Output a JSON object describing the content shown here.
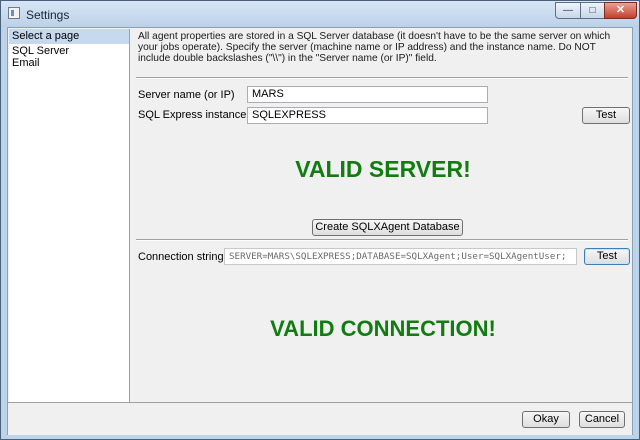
{
  "window": {
    "title": "Settings"
  },
  "sidebar": {
    "header": "Select a page",
    "items": [
      {
        "label": "SQL Server"
      },
      {
        "label": "Email"
      }
    ]
  },
  "main": {
    "description": "All agent properties are stored in a SQL Server database (it doesn't have to be the same server on which your jobs operate). Specify the server (machine name or IP address) and the instance name. Do NOT include double backslashes (\"\\\\\") in the \"Server name (or IP)\" field.",
    "server_label": "Server name (or IP)",
    "server_value": "MARS",
    "instance_label": "SQL Express instance",
    "instance_value": "SQLEXPRESS",
    "test_label": "Test",
    "server_status": "VALID SERVER!",
    "create_db_label": "Create SQLXAgent Database",
    "connection_label": "Connection string",
    "connection_value": "SERVER=MARS\\SQLEXPRESS;DATABASE=SQLXAgent;User=SQLXAgentUser;",
    "test2_label": "Test",
    "connection_status": "VALID CONNECTION!"
  },
  "footer": {
    "ok_label": "Okay",
    "cancel_label": "Cancel"
  },
  "colors": {
    "status_green": "#127c12",
    "sidebar_selected": "#c6d9ef"
  }
}
